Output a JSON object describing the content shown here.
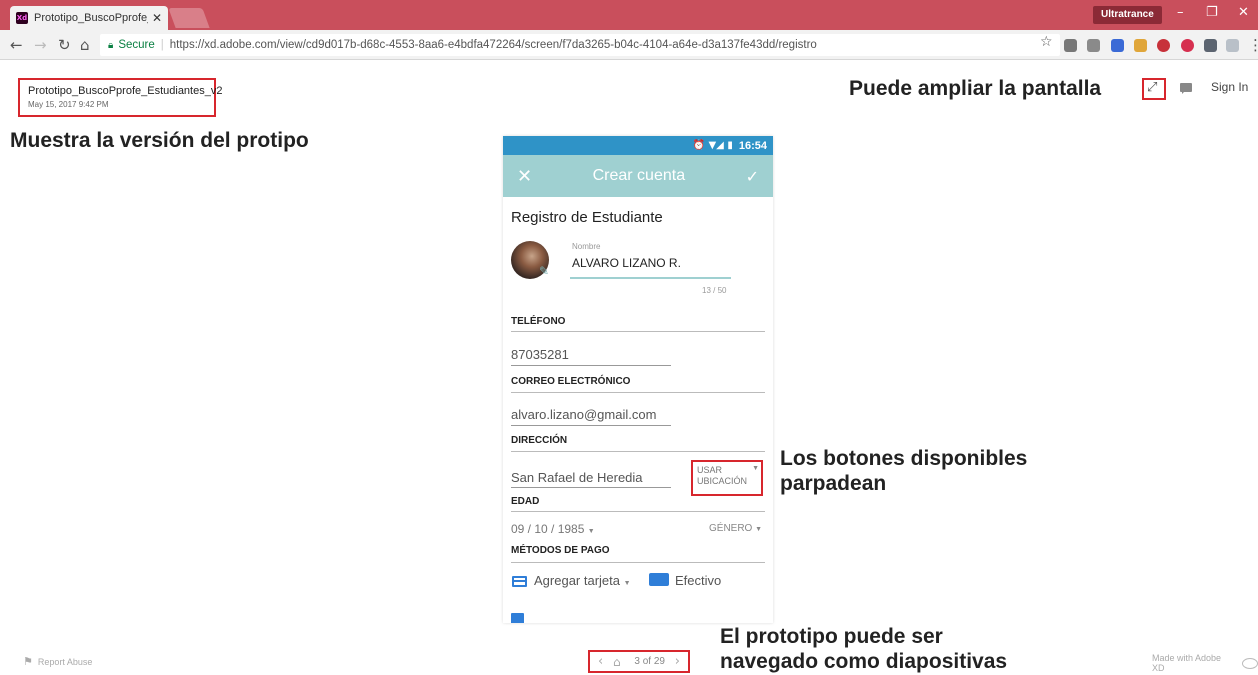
{
  "browser": {
    "tab_title": "Prototipo_BuscoPprofe_E",
    "tab_favicon": "Xd",
    "profile_label": "Ultratrance",
    "secure_label": "Secure",
    "url": "https://xd.adobe.com/view/cd9d017b-d68c-4553-8aa6-e4bdfa472264/screen/f7da3265-b04c-4104-a64e-d3a137fe43dd/registro"
  },
  "viewer": {
    "project_name": "Prototipo_BuscoPprofe_Estudiantes_v2",
    "project_date": "May 15, 2017 9:42 PM",
    "sign_in": "Sign In",
    "report_abuse": "Report Abuse",
    "made_with": "Made with Adobe XD",
    "pager": "3 of 29"
  },
  "annotations": {
    "version": "Muestra la versión del protipo",
    "zoom": "Puede ampliar la pantalla",
    "buttons_line1": "Los botones disponibles",
    "buttons_line2": "parpadean",
    "slides_line1": "El prototipo puede ser",
    "slides_line2": "navegado como diapositivas"
  },
  "phone": {
    "time": "16:54",
    "appbar_title": "Crear cuenta",
    "form_title": "Registro de Estudiante",
    "name_label": "Nombre",
    "name_value": "ALVARO LIZANO R.",
    "name_count": "13 / 50",
    "phone_label": "TELÉFONO",
    "phone_value": "87035281",
    "email_label": "CORREO ELECTRÓNICO",
    "email_value": "alvaro.lizano@gmail.com",
    "address_label": "DIRECCIÓN",
    "address_value": "San Rafael de Heredia",
    "use_location_line1": "USAR",
    "use_location_line2": "UBICACIÓN",
    "age_label": "EDAD",
    "birth_date": "09 / 10 / 1985",
    "gender": "GÉNERO",
    "payment_label": "MÉTODOS DE PAGO",
    "add_card": "Agregar tarjeta",
    "cash": "Efectivo"
  },
  "colors": {
    "browser_chrome": "#c94f5c",
    "highlight_box": "#d7262d",
    "status_bar": "#2f93c7",
    "app_bar": "#9fd0d1",
    "accent_blue": "#2f7ed8"
  }
}
